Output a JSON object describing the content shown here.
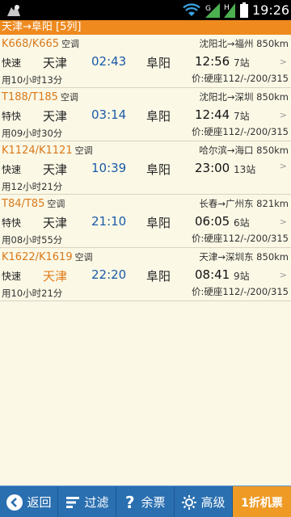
{
  "status_bar": {
    "time": "19:26"
  },
  "route": {
    "title": "天津→阜阳 [5列]"
  },
  "trains": [
    {
      "no": "K668/K665",
      "ac": "空调",
      "endpoints": "沈阳北→福州 850km",
      "type": "快速",
      "from": "天津",
      "dep": "02:43",
      "to": "阜阳",
      "arr": "12:56",
      "stops": "7站",
      "duration": "用10小时13分",
      "price": "价:硬座112/-/200/315",
      "from_highlight": false
    },
    {
      "no": "T188/T185",
      "ac": "空调",
      "endpoints": "沈阳北→深圳 850km",
      "type": "特快",
      "from": "天津",
      "dep": "03:14",
      "to": "阜阳",
      "arr": "12:44",
      "stops": "7站",
      "duration": "用09小时30分",
      "price": "价:硬座112/-/200/315",
      "from_highlight": false
    },
    {
      "no": "K1124/K1121",
      "ac": "空调",
      "endpoints": "哈尔滨→海口 850km",
      "type": "快速",
      "from": "天津",
      "dep": "10:39",
      "to": "阜阳",
      "arr": "23:00",
      "stops": "13站",
      "duration": "用12小时21分",
      "price": "",
      "from_highlight": false
    },
    {
      "no": "T84/T85",
      "ac": "空调",
      "endpoints": "长春→广州东 821km",
      "type": "特快",
      "from": "天津",
      "dep": "21:10",
      "to": "阜阳",
      "arr": "06:05",
      "stops": "6站",
      "duration": "用08小时55分",
      "price": "价:硬座112/-/200/315",
      "from_highlight": false
    },
    {
      "no": "K1622/K1619",
      "ac": "空调",
      "endpoints": "天津→深圳东 850km",
      "type": "快速",
      "from": "天津",
      "dep": "22:20",
      "to": "阜阳",
      "arr": "08:41",
      "stops": "9站",
      "duration": "用10小时21分",
      "price": "价:硬座112/-/200/315",
      "from_highlight": true
    }
  ],
  "row_arrow": ">",
  "toolbar": {
    "back": "返回",
    "filter": "过滤",
    "tickets": "余票",
    "advanced": "高级",
    "flight": "1折机票"
  }
}
